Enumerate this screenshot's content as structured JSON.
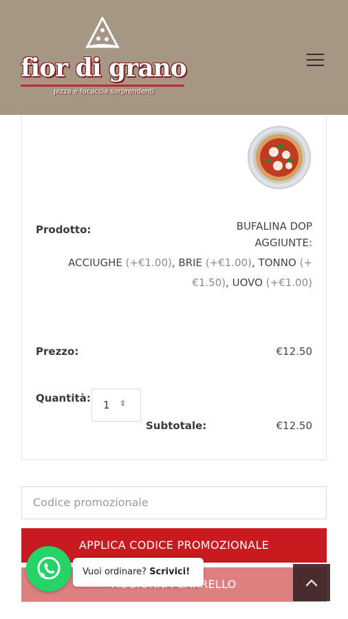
{
  "header": {
    "brand": "fior di grano",
    "tagline": "pizza e focaccia sorprendenti",
    "logo_icon": "pizza-slice-icon",
    "menu_icon": "hamburger-menu-icon",
    "background_color": "#a69684",
    "accent_color": "#c0262d"
  },
  "cart_item": {
    "image_icon": "pizza-image",
    "product_label": "Prodotto:",
    "product_name": "BUFALINA DOP",
    "addons_label": "AGGIUNTE:",
    "addons_line1": {
      "a": "ACCIUGHE",
      "a_price": "(+€1.00)",
      "sep1": ", BRIE",
      "b_price": "(+€1.00)",
      "sep2": ", TONNO",
      "c_price_start": "(+"
    },
    "addons_line2": {
      "c_price_end": "€1.50)",
      "sep": ", UOVO",
      "d_price": "(+€1.00)"
    },
    "price_label": "Prezzo:",
    "price": "€12.50",
    "quantity_label": "Quantità:",
    "quantity": "1",
    "subtotal_label": "Subtotale:",
    "subtotal": "€12.50"
  },
  "promo": {
    "placeholder": "Codice promozionale",
    "apply_label": "APPLICA CODICE PROMOZIONALE",
    "update_label": "AGGIORNA CARRELLO"
  },
  "whatsapp": {
    "icon": "whatsapp-icon",
    "text": "Vuoi ordinare?",
    "cta": "Scrivici!"
  },
  "scroll_top": {
    "icon": "chevron-up-icon"
  }
}
